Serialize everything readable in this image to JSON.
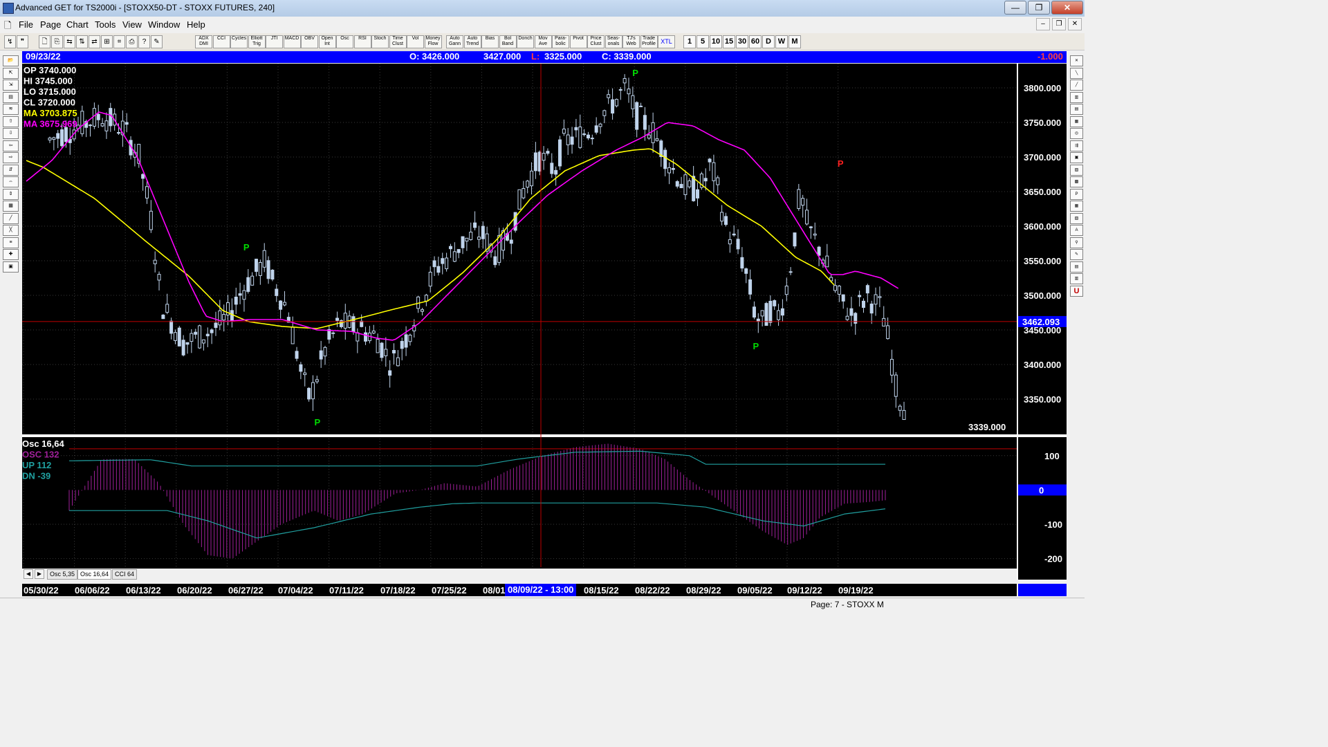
{
  "window": {
    "title": "Advanced GET for TS2000i - [STOXX50-DT - STOXX FUTURES, 240]",
    "buttons": [
      "—",
      "❐",
      "✕"
    ]
  },
  "menu": [
    "File",
    "Page",
    "Chart",
    "Tools",
    "View",
    "Window",
    "Help"
  ],
  "toolbar": {
    "studies": [
      "ADX DMI",
      "CCI",
      "Cycles",
      "Elliott Trig",
      "JTI",
      "MACD",
      "OBV",
      "Open Int",
      "Osc",
      "RSI",
      "Stoch",
      "Time Clust",
      "Vol",
      "Money Flow",
      "Auto Gann",
      "Auto Trend",
      "Bias",
      "Bol Band",
      "Donch",
      "Mov Ave",
      "Para-bolic",
      "Pivot",
      "Price Clust",
      "Seas-onals",
      "TJ's Web",
      "Trade Profile",
      "XTL"
    ],
    "timeframes": [
      "1",
      "5",
      "10",
      "15",
      "30",
      "60",
      "D",
      "W",
      "M"
    ]
  },
  "info_bar": {
    "date": "09/23/22",
    "open": "O: 3426.000",
    "high": "3427.000",
    "low_label": "L:",
    "low": "3325.000",
    "close": "C: 3339.000",
    "change": "-1.000"
  },
  "legend": {
    "op": "OP 3740.000",
    "hi": "HI  3745.000",
    "lo": "LO  3715.000",
    "cl": "CL  3720.000",
    "ma1": "MA  3703.875",
    "ma2": "MA  3675.969"
  },
  "osc_legend": {
    "title": "Osc 16,64",
    "osc": "OSC  132",
    "up": "UP   112",
    "dn": "DN   -39"
  },
  "tabs": [
    "Osc 5,35",
    "Osc 16,64",
    "CCI 64"
  ],
  "dates": [
    "05/30/22",
    "06/06/22",
    "06/13/22",
    "06/20/22",
    "06/27/22",
    "07/04/22",
    "07/11/22",
    "07/18/22",
    "07/25/22",
    "08/01",
    "08/15/22",
    "08/22/22",
    "08/29/22",
    "09/05/22",
    "09/12/22",
    "09/19/22"
  ],
  "cursor_date": "08/09/22 - 13:00",
  "status": "Page: 7 - STOXX M",
  "colors": {
    "background": "#000000",
    "candle": "#c0d4ec",
    "ma_fast": "#ffff00",
    "ma_slow": "#ff00ff",
    "osc": "#a0209a",
    "up_dn": "#20a0a0",
    "pivot_low": "#00dd00",
    "pivot_high": "#ff2020",
    "crosshair": "#c00000",
    "info_bar": "#0000ff"
  },
  "chart_data": [
    {
      "type": "candlestick",
      "price_axis_ticks": [
        "3800.000",
        "3750.000",
        "3700.000",
        "3650.000",
        "3600.000",
        "3550.000",
        "3500.000",
        "3450.000",
        "3400.000",
        "3350.000"
      ],
      "ylim": [
        3300,
        3835
      ],
      "crosshair_price": "3462.093",
      "last_price": "3339.000",
      "x_range": [
        "05/30/22",
        "09/23/22"
      ],
      "series": [
        {
          "name": "MA",
          "anchors": [
            [
              0,
              3695
            ],
            [
              0.02,
              3685
            ],
            [
              0.08,
              3640
            ],
            [
              0.14,
              3578
            ],
            [
              0.19,
              3528
            ],
            [
              0.23,
              3478
            ],
            [
              0.26,
              3462
            ],
            [
              0.3,
              3455
            ],
            [
              0.34,
              3452
            ],
            [
              0.38,
              3464
            ],
            [
              0.43,
              3480
            ],
            [
              0.47,
              3492
            ],
            [
              0.51,
              3532
            ],
            [
              0.55,
              3580
            ],
            [
              0.59,
              3640
            ],
            [
              0.63,
              3680
            ],
            [
              0.67,
              3702
            ],
            [
              0.71,
              3710
            ],
            [
              0.73,
              3712
            ],
            [
              0.76,
              3690
            ],
            [
              0.79,
              3660
            ],
            [
              0.82,
              3630
            ],
            [
              0.86,
              3600
            ],
            [
              0.9,
              3555
            ],
            [
              0.93,
              3535
            ],
            [
              0.945,
              3515
            ]
          ]
        },
        {
          "name": "MA",
          "anchors": [
            [
              0,
              3665
            ],
            [
              0.03,
              3695
            ],
            [
              0.06,
              3740
            ],
            [
              0.085,
              3765
            ],
            [
              0.1,
              3760
            ],
            [
              0.13,
              3700
            ],
            [
              0.16,
              3610
            ],
            [
              0.19,
              3520
            ],
            [
              0.21,
              3470
            ],
            [
              0.23,
              3462
            ],
            [
              0.26,
              3465
            ],
            [
              0.3,
              3465
            ],
            [
              0.34,
              3450
            ],
            [
              0.38,
              3448
            ],
            [
              0.41,
              3438
            ],
            [
              0.43,
              3435
            ],
            [
              0.46,
              3460
            ],
            [
              0.5,
              3510
            ],
            [
              0.54,
              3560
            ],
            [
              0.58,
              3610
            ],
            [
              0.61,
              3645
            ],
            [
              0.65,
              3680
            ],
            [
              0.69,
              3710
            ],
            [
              0.72,
              3728
            ],
            [
              0.75,
              3750
            ],
            [
              0.78,
              3745
            ],
            [
              0.81,
              3725
            ],
            [
              0.84,
              3710
            ],
            [
              0.87,
              3670
            ],
            [
              0.9,
              3610
            ],
            [
              0.925,
              3560
            ],
            [
              0.94,
              3530
            ],
            [
              0.955,
              3530
            ],
            [
              0.97,
              3535
            ],
            [
              1.0,
              3525
            ],
            [
              1.02,
              3510
            ]
          ]
        }
      ],
      "pivots": [
        {
          "label": "P",
          "kind": "low",
          "x": 0.258,
          "price": 3581
        },
        {
          "label": "P",
          "kind": "low",
          "x": 0.341,
          "price": 3328
        },
        {
          "label": "P",
          "kind": "high",
          "x": 0.713,
          "price": 3813
        },
        {
          "label": "P",
          "kind": "low",
          "x": 0.854,
          "price": 3438
        },
        {
          "label": "P",
          "kind": "high",
          "x": 0.953,
          "price": 3682
        }
      ]
    },
    {
      "type": "bar",
      "name": "Osc 16,64",
      "axis_ticks": [
        "100",
        "0",
        "-100",
        "-200"
      ],
      "ylim": [
        -225,
        150
      ],
      "zero_label": "0",
      "up_line": 112,
      "osc_anchors": [
        [
          0,
          -60
        ],
        [
          0.04,
          90
        ],
        [
          0.08,
          90
        ],
        [
          0.11,
          20
        ],
        [
          0.14,
          -100
        ],
        [
          0.17,
          -190
        ],
        [
          0.2,
          -200
        ],
        [
          0.23,
          -150
        ],
        [
          0.26,
          -100
        ],
        [
          0.3,
          -60
        ],
        [
          0.33,
          -90
        ],
        [
          0.36,
          -70
        ],
        [
          0.4,
          -10
        ],
        [
          0.43,
          0
        ],
        [
          0.46,
          20
        ],
        [
          0.5,
          10
        ],
        [
          0.54,
          60
        ],
        [
          0.58,
          100
        ],
        [
          0.62,
          125
        ],
        [
          0.66,
          135
        ],
        [
          0.7,
          120
        ],
        [
          0.73,
          90
        ],
        [
          0.76,
          30
        ],
        [
          0.79,
          -20
        ],
        [
          0.82,
          -70
        ],
        [
          0.85,
          -120
        ],
        [
          0.88,
          -160
        ],
        [
          0.9,
          -140
        ],
        [
          0.92,
          -80
        ],
        [
          0.95,
          -40
        ],
        [
          0.98,
          -35
        ],
        [
          1.0,
          -30
        ]
      ],
      "up_anchors": [
        [
          0,
          85
        ],
        [
          0.1,
          88
        ],
        [
          0.15,
          70
        ],
        [
          0.45,
          70
        ],
        [
          0.5,
          70
        ],
        [
          0.55,
          90
        ],
        [
          0.62,
          110
        ],
        [
          0.7,
          113
        ],
        [
          0.76,
          100
        ],
        [
          0.78,
          75
        ],
        [
          1.0,
          75
        ]
      ],
      "dn_anchors": [
        [
          0,
          -60
        ],
        [
          0.12,
          -60
        ],
        [
          0.17,
          -90
        ],
        [
          0.23,
          -140
        ],
        [
          0.3,
          -110
        ],
        [
          0.37,
          -70
        ],
        [
          0.43,
          -50
        ],
        [
          0.47,
          -40
        ],
        [
          0.5,
          -38
        ],
        [
          0.6,
          -38
        ],
        [
          0.65,
          -38
        ],
        [
          0.72,
          -38
        ],
        [
          0.78,
          -50
        ],
        [
          0.85,
          -90
        ],
        [
          0.9,
          -105
        ],
        [
          0.95,
          -70
        ],
        [
          1.0,
          -55
        ]
      ]
    }
  ]
}
